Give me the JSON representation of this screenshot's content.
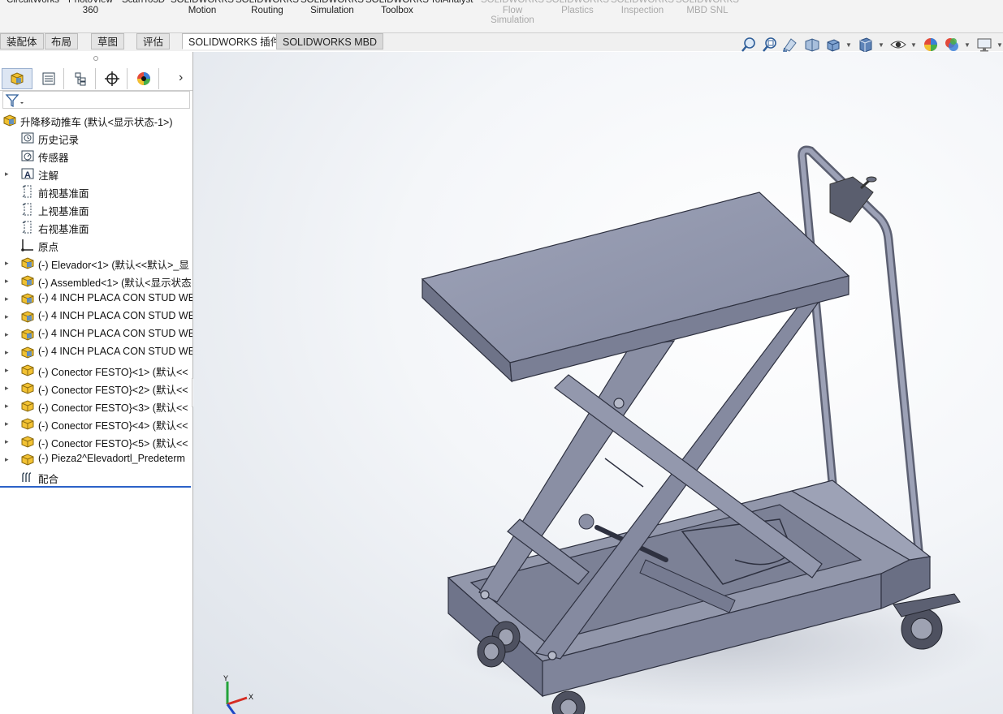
{
  "ribbon": {
    "items": [
      {
        "label": "CircuitWorks",
        "disabled": false
      },
      {
        "label": "PhotoView\n360",
        "disabled": false
      },
      {
        "label": "ScanTo3D",
        "disabled": false
      },
      {
        "label": "SOLIDWORKS\nMotion",
        "disabled": false
      },
      {
        "label": "SOLIDWORKS\nRouting",
        "disabled": false
      },
      {
        "label": "SOLIDWORKS\nSimulation",
        "disabled": false
      },
      {
        "label": "SOLIDWORKS\nToolbox",
        "disabled": false
      },
      {
        "label": "TolAnalyst",
        "disabled": false
      },
      {
        "label": "SOLIDWORKS\nFlow\nSimulation",
        "disabled": true
      },
      {
        "label": "SOLIDWORKS\nPlastics",
        "disabled": true
      },
      {
        "label": "SOLIDWORKS\nInspection",
        "disabled": true
      },
      {
        "label": "SOLIDWORKS\nMBD SNL",
        "disabled": true
      }
    ]
  },
  "tabs": [
    "装配体",
    "布局",
    "草图",
    "评估",
    "SOLIDWORKS 插件",
    "SOLIDWORKS MBD"
  ],
  "active_tab": "SOLIDWORKS 插件",
  "hud_icons": [
    "zoom-to-fit-icon",
    "zoom-to-area-icon",
    "previous-view-icon",
    "section-view-icon",
    "view-orientation-icon",
    "display-style-icon",
    "hide-show-items-icon",
    "edit-appearance-icon",
    "apply-scene-icon",
    "view-settings-icon"
  ],
  "panel_tabs": [
    "featuremanager-icon",
    "propertymanager-icon",
    "configurationmanager-icon",
    "dimxpertmanager-icon",
    "displaymanager-icon"
  ],
  "tree": {
    "root": "升降移动推车 (默认<显示状态-1>)",
    "items": [
      {
        "label": "历史记录",
        "icon": "history-icon",
        "expandable": false
      },
      {
        "label": "传感器",
        "icon": "sensor-icon",
        "expandable": false
      },
      {
        "label": "注解",
        "icon": "annotation-icon",
        "expandable": true
      },
      {
        "label": "前视基准面",
        "icon": "plane-icon",
        "expandable": false
      },
      {
        "label": "上视基准面",
        "icon": "plane-icon",
        "expandable": false
      },
      {
        "label": "右视基准面",
        "icon": "plane-icon",
        "expandable": false
      },
      {
        "label": "原点",
        "icon": "origin-icon",
        "expandable": false
      },
      {
        "label": "(-) Elevador<1> (默认<<默认>_显",
        "icon": "subassembly-icon",
        "expandable": true
      },
      {
        "label": "(-) Assembled<1> (默认<显示状态",
        "icon": "subassembly-icon",
        "expandable": true
      },
      {
        "label": "(-) 4 INCH PLACA CON STUD WE",
        "icon": "subassembly-icon",
        "expandable": true
      },
      {
        "label": "(-) 4 INCH PLACA CON STUD WE",
        "icon": "subassembly-icon",
        "expandable": true
      },
      {
        "label": "(-) 4 INCH PLACA CON STUD WE",
        "icon": "subassembly-icon",
        "expandable": true
      },
      {
        "label": "(-) 4 INCH PLACA CON STUD WE",
        "icon": "subassembly-icon",
        "expandable": true
      },
      {
        "label": "(-) Conector FESTO}<1> (默认<<",
        "icon": "part-icon",
        "expandable": true
      },
      {
        "label": "(-) Conector FESTO}<2> (默认<<",
        "icon": "part-icon",
        "expandable": true
      },
      {
        "label": "(-) Conector FESTO}<3> (默认<<",
        "icon": "part-icon",
        "expandable": true
      },
      {
        "label": "(-) Conector FESTO}<4> (默认<<",
        "icon": "part-icon",
        "expandable": true
      },
      {
        "label": "(-) Conector FESTO}<5> (默认<<",
        "icon": "part-icon",
        "expandable": true
      },
      {
        "label": "(-) Pieza2^Elevadortl_Predeterm",
        "icon": "part-icon",
        "expandable": true
      },
      {
        "label": "配合",
        "icon": "mates-icon",
        "expandable": false
      }
    ]
  },
  "triad": {
    "x": "X",
    "y": "Y"
  },
  "colors": {
    "accent": "#2b62c8",
    "metal": "#8d93a8",
    "part_yellow": "#e8b62a"
  }
}
